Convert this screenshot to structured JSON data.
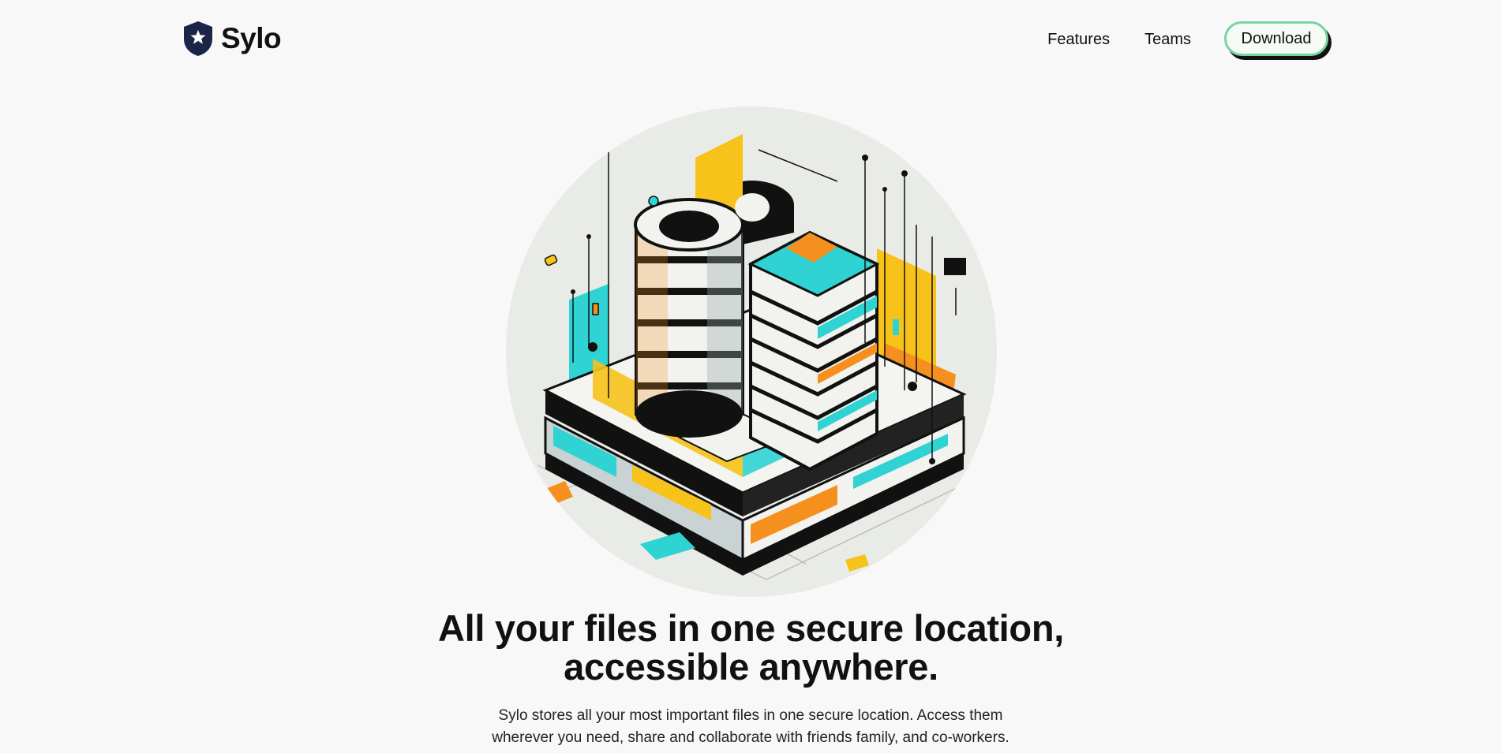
{
  "brand": {
    "name": "Sylo",
    "logo_icon": "shield-star-icon"
  },
  "nav": {
    "links": [
      {
        "label": "Features"
      },
      {
        "label": "Teams"
      }
    ],
    "download_label": "Download"
  },
  "hero": {
    "image_icon": "isometric-data-center-illustration",
    "headline_line1": "All your files in one secure location,",
    "headline_line2": "accessible anywhere.",
    "subtext_line1": "Sylo stores all your most important files in one secure location. Access them",
    "subtext_line2": "wherever you need, share and collaborate with friends family, and co-workers."
  },
  "colors": {
    "background": "#f7f8f7",
    "accent_green": "#74d7a0",
    "cyan": "#2fd3d3",
    "yellow": "#f7c21a",
    "orange": "#f5901e",
    "navy": "#1b2547"
  }
}
